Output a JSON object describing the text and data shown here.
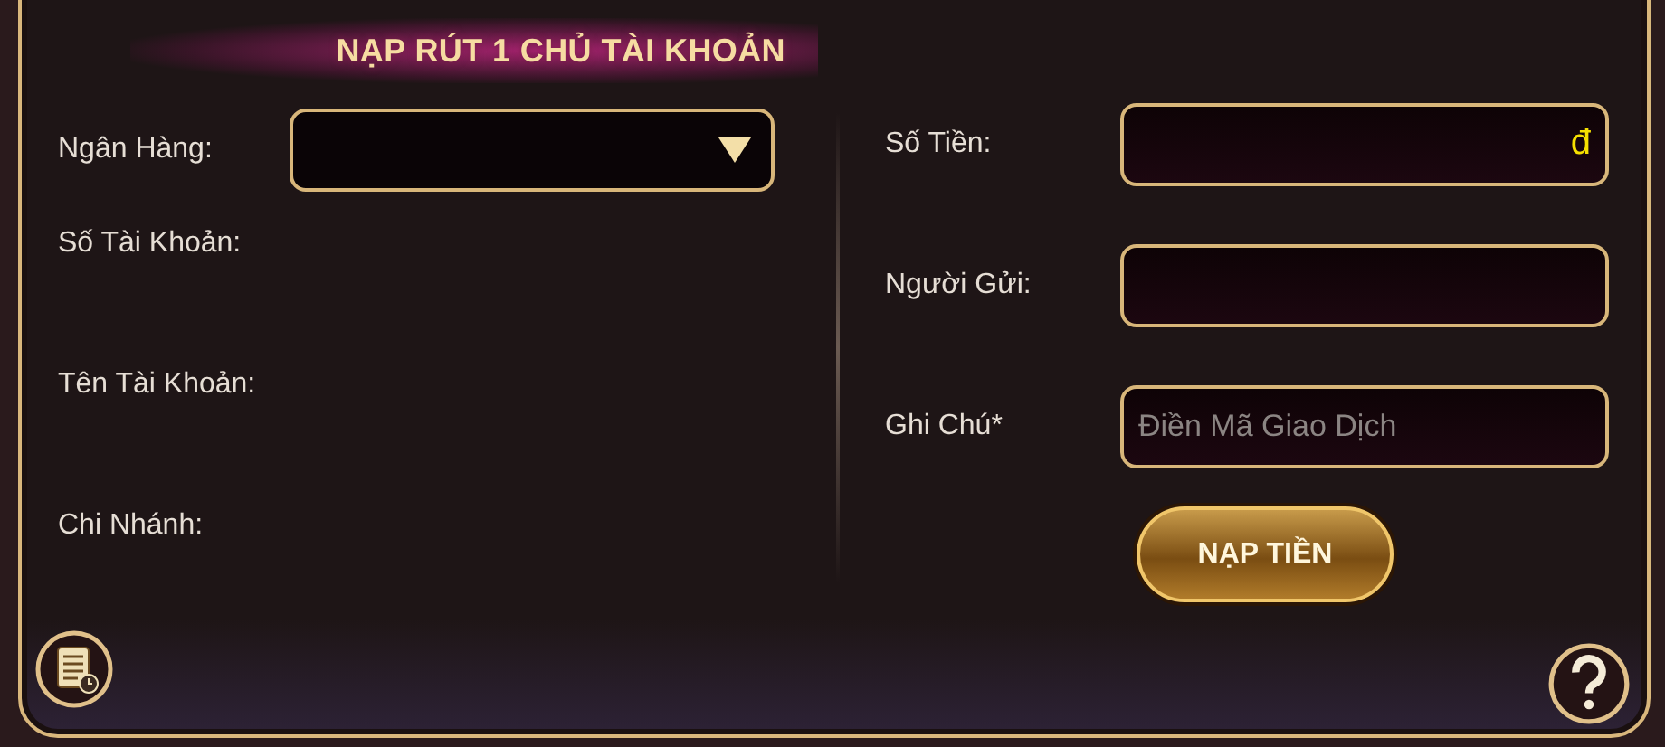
{
  "title": "NẠP RÚT 1 CHỦ TÀI KHOẢN",
  "left_fields": [
    {
      "label": "Ngân Hàng:",
      "kind": "select"
    },
    {
      "label": "Số Tài Khoản:",
      "kind": "text"
    },
    {
      "label": "Tên Tài Khoản:",
      "kind": "text"
    },
    {
      "label": "Chi Nhánh:",
      "kind": "text"
    }
  ],
  "right_fields": [
    {
      "label": "Số Tiền:",
      "suffix": "đ"
    },
    {
      "label": "Người Gửi:"
    },
    {
      "label": "Ghi Chú*",
      "placeholder": "Điền Mã Giao Dịch"
    }
  ],
  "submit_button": "NẠP TIỀN"
}
